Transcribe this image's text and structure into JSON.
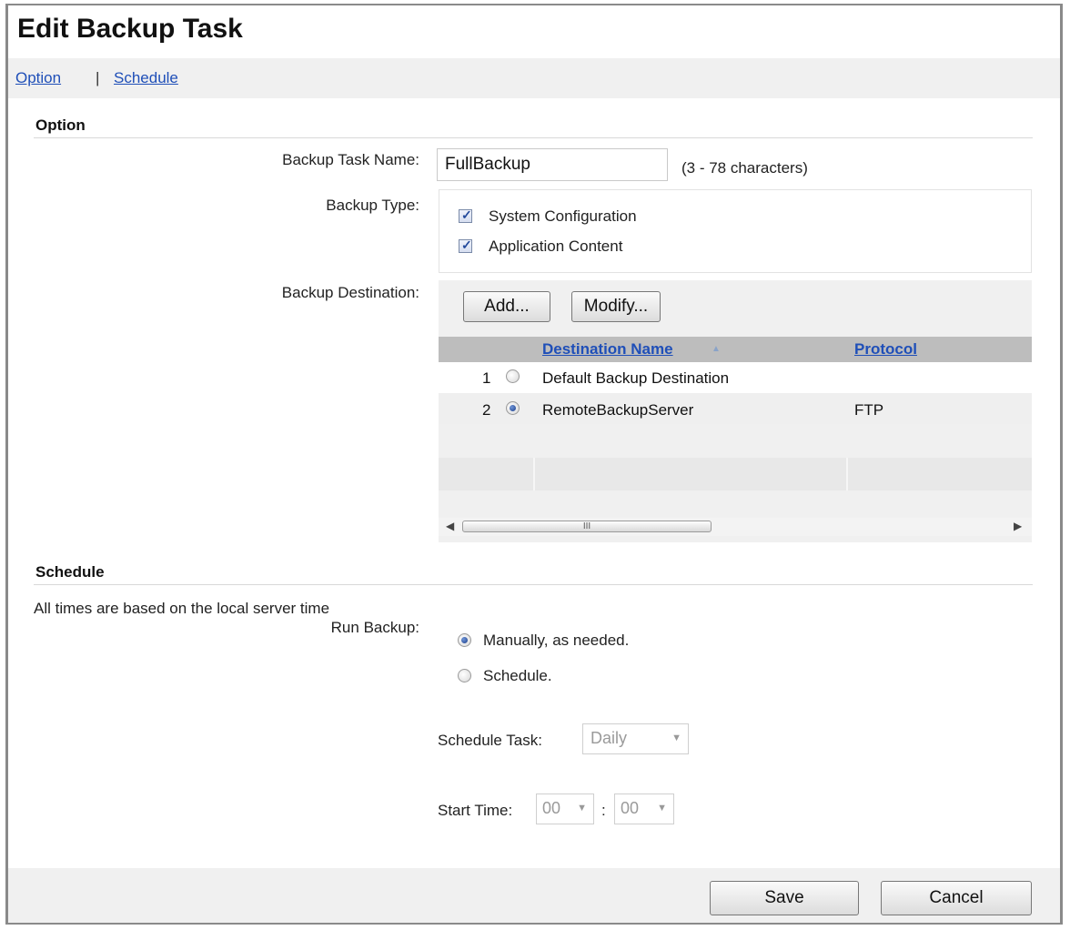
{
  "page": {
    "title": "Edit Backup Task"
  },
  "nav": {
    "option_link": "Option",
    "separator": "|",
    "schedule_link": "Schedule"
  },
  "option": {
    "heading": "Option",
    "task_name_label": "Backup Task Name:",
    "task_name_value": "FullBackup",
    "task_name_hint": "(3 - 78 characters)",
    "backup_type_label": "Backup Type:",
    "types": [
      {
        "label": "System Configuration",
        "checked": true
      },
      {
        "label": "Application Content",
        "checked": true
      }
    ],
    "destination_label": "Backup Destination:",
    "add_button": "Add...",
    "modify_button": "Modify...",
    "table": {
      "columns": [
        "Destination Name",
        "Protocol"
      ],
      "sort_indicator": "▲",
      "rows": [
        {
          "index": "1",
          "selected": false,
          "name": "Default Backup Destination",
          "protocol": ""
        },
        {
          "index": "2",
          "selected": true,
          "name": "RemoteBackupServer",
          "protocol": "FTP"
        }
      ]
    },
    "scroll_grip": "III"
  },
  "schedule": {
    "heading": "Schedule",
    "note": "All times are based on the local server time",
    "run_label": "Run Backup:",
    "run_options": [
      {
        "label": "Manually, as needed.",
        "selected": true
      },
      {
        "label": "Schedule.",
        "selected": false
      }
    ],
    "task_label": "Schedule Task:",
    "task_value": "Daily",
    "start_label": "Start Time:",
    "hour_value": "00",
    "time_sep": ":",
    "minute_value": "00"
  },
  "footer": {
    "save_button": "Save",
    "cancel_button": "Cancel"
  }
}
